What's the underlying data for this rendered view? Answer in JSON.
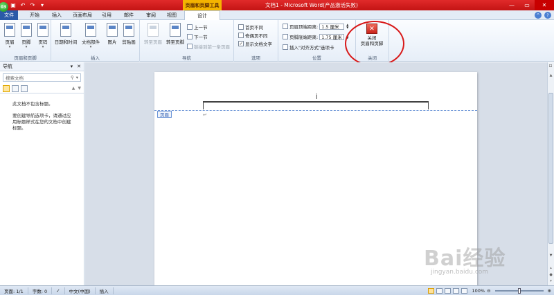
{
  "qat": {
    "save_icon": "save-icon",
    "undo_icon": "undo-icon",
    "redo_icon": "redo-icon",
    "more_icon": "chevron-down-icon"
  },
  "app_logo": "03",
  "context_tab_title": "页眉和页脚工具",
  "doc_title": "文档1 - Microsoft Word(产品激活失败)",
  "tabs": [
    {
      "label": "文件"
    },
    {
      "label": "开始"
    },
    {
      "label": "插入"
    },
    {
      "label": "页面布局"
    },
    {
      "label": "引用"
    },
    {
      "label": "邮件"
    },
    {
      "label": "审阅"
    },
    {
      "label": "视图"
    },
    {
      "label": "设计"
    }
  ],
  "ribbon": {
    "header_footer_group": {
      "label": "页眉和页脚",
      "buttons": [
        "页眉",
        "页脚",
        "页码"
      ]
    },
    "insert_group": {
      "label": "插入",
      "buttons": [
        "日期和时间",
        "文档部件",
        "图片",
        "剪贴画"
      ]
    },
    "navigation_group": {
      "label": "导航",
      "goto_header": "转至页眉",
      "goto_footer": "转至页脚",
      "prev": "上一节",
      "next": "下一节",
      "link_prev": "链接到前一条页眉"
    },
    "options_group": {
      "label": "选项",
      "first_page": "首页不同",
      "odd_even": "奇偶页不同",
      "show_text": "显示文档文字",
      "show_text_checked": "✓"
    },
    "position_group": {
      "label": "位置",
      "header_top": "页眉顶端距离:",
      "header_top_value": "1.5 厘米",
      "footer_bottom": "页脚底端距离:",
      "footer_bottom_value": "1.75 厘米",
      "insert_align": "插入\"对齐方式\"选项卡"
    },
    "close_group": {
      "label": "关闭",
      "close_line1": "关闭",
      "close_line2": "页眉和页脚"
    }
  },
  "nav": {
    "title": "导航",
    "search_placeholder": "搜索文档",
    "msg1": "此文档不包含标题。",
    "msg2": "要创建导航选项卡，请通过应用标题样式在您的文档中创建标题。"
  },
  "doc": {
    "header_tag": "页眉",
    "para_mark": "↵",
    "cursor_mark": "Ì"
  },
  "status": {
    "page": "页面: 1/1",
    "words": "字数: 0",
    "lang": "中文(中国)",
    "mode": "插入",
    "zoom": "100%"
  },
  "watermark": {
    "text": "Bai经验",
    "url": "jingyan.baidu.com"
  },
  "colors": {
    "titlebar": "#d31c1c",
    "file_tab": "#2b5aa8",
    "context_tab": "#f4b400",
    "highlight_circle": "#d81818"
  }
}
